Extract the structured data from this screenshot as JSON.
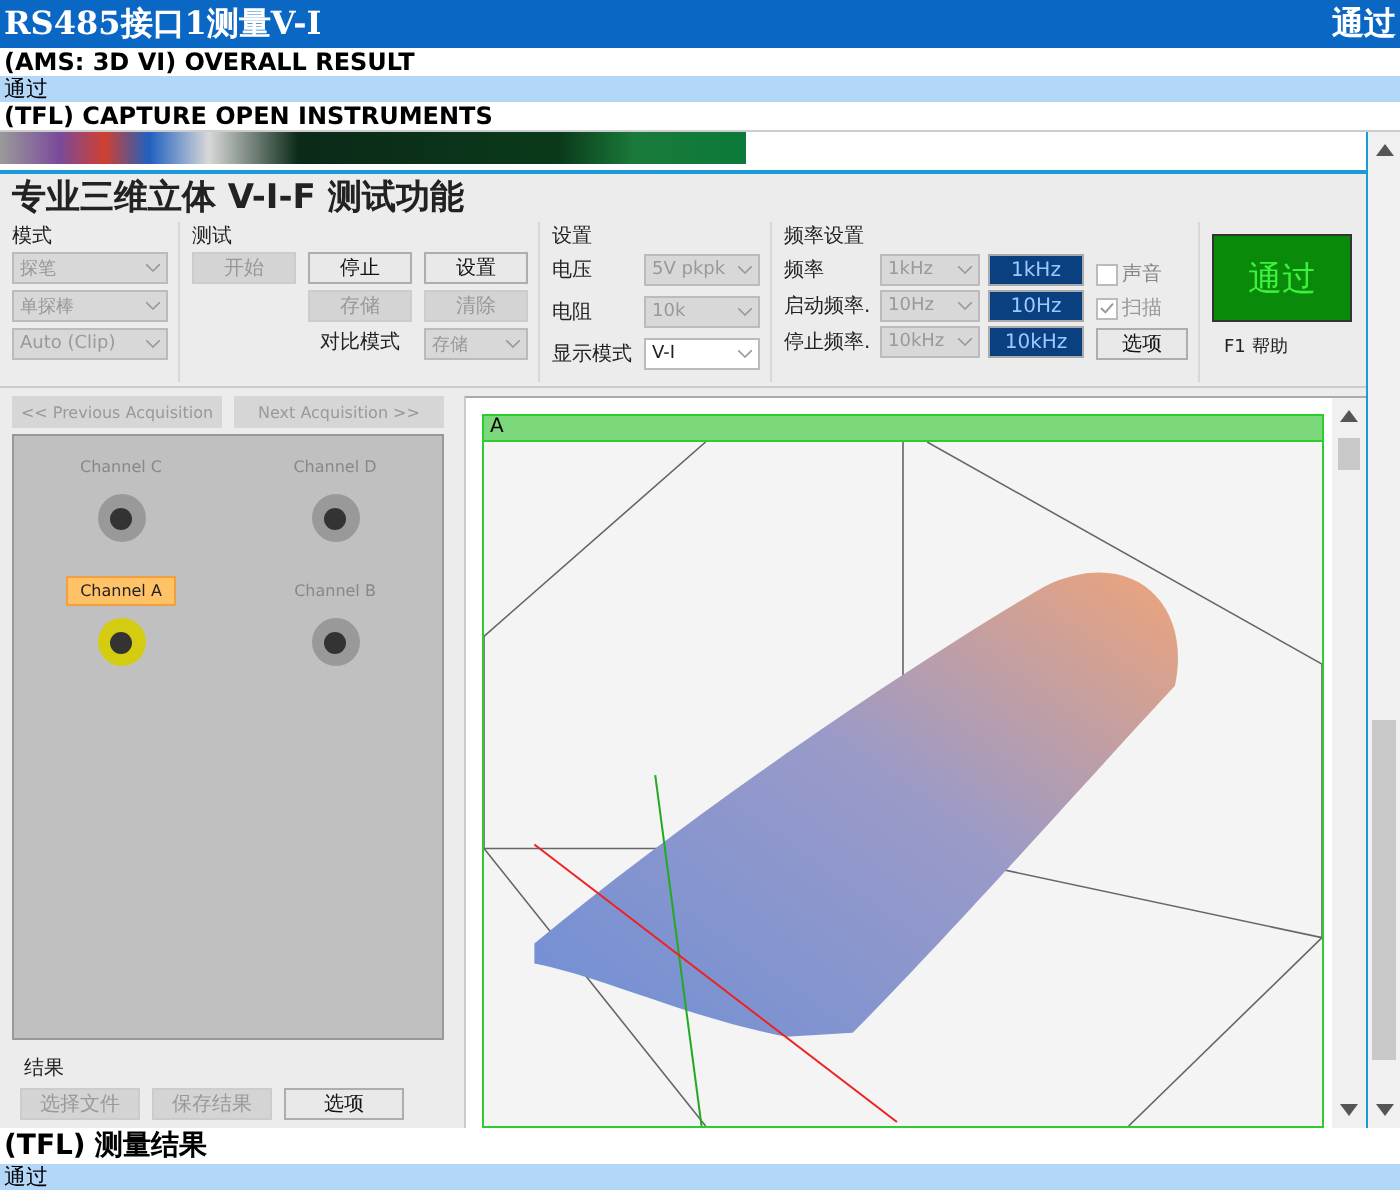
{
  "header": {
    "title": "RS485接口1测量V-I",
    "status": "通过"
  },
  "steps": [
    {
      "name": "(AMS: 3D VI) OVERALL RESULT",
      "result": "通过"
    },
    {
      "name": "(TFL) CAPTURE OPEN INSTRUMENTS"
    }
  ],
  "app": {
    "title": "专业三维立体 V-I-F 测试功能",
    "mode_group": {
      "label": "模式",
      "selects": [
        {
          "value": "探笔",
          "disabled": true
        },
        {
          "value": "单探棒",
          "disabled": true
        },
        {
          "value": "Auto (Clip)",
          "disabled": true
        }
      ]
    },
    "test_group": {
      "label": "测试",
      "buttons": [
        {
          "label": "开始",
          "disabled": true
        },
        {
          "label": "停止",
          "disabled": false
        },
        {
          "label": "设置",
          "disabled": false
        },
        {
          "label": "存储",
          "disabled": true
        },
        {
          "label": "清除",
          "disabled": true
        }
      ],
      "compare_label": "对比模式",
      "compare_select": {
        "value": "存储",
        "disabled": true
      }
    },
    "settings_group": {
      "label": "设置",
      "rows": [
        {
          "label": "电压",
          "value": "5V pkpk",
          "disabled": true
        },
        {
          "label": "电阻",
          "value": "10k",
          "disabled": true
        },
        {
          "label": "显示模式",
          "value": "V-I",
          "disabled": false
        }
      ]
    },
    "freq_group": {
      "label": "频率设置",
      "rows": [
        {
          "label": "频率",
          "value": "1kHz",
          "display": "1kHz",
          "disabled": true
        },
        {
          "label": "启动频率.",
          "value": "10Hz",
          "display": "10Hz",
          "disabled": true
        },
        {
          "label": "停止频率.",
          "value": "10kHz",
          "display": "10kHz",
          "disabled": true
        }
      ],
      "checkboxes": [
        {
          "label": "声音",
          "checked": false,
          "disabled": false
        },
        {
          "label": "扫描",
          "checked": true,
          "disabled": true
        }
      ],
      "options_button": "选项"
    },
    "result": {
      "text": "通过",
      "help": "F1 帮助"
    },
    "acquisition_buttons": [
      {
        "label": "<< Previous Acquisition",
        "disabled": true
      },
      {
        "label": "Next Acquisition >>",
        "disabled": true
      }
    ],
    "channels": [
      {
        "label": "Channel C",
        "selected": false
      },
      {
        "label": "Channel D",
        "selected": false
      },
      {
        "label": "Channel A",
        "selected": true
      },
      {
        "label": "Channel B",
        "selected": false
      }
    ],
    "results_group": {
      "label": "结果",
      "buttons": [
        {
          "label": "选择文件",
          "disabled": true
        },
        {
          "label": "保存结果",
          "disabled": true
        },
        {
          "label": "选项",
          "disabled": false
        }
      ]
    },
    "plot": {
      "label": "A"
    }
  },
  "final_step": {
    "name": "(TFL) 测量结果",
    "result": "通过"
  }
}
